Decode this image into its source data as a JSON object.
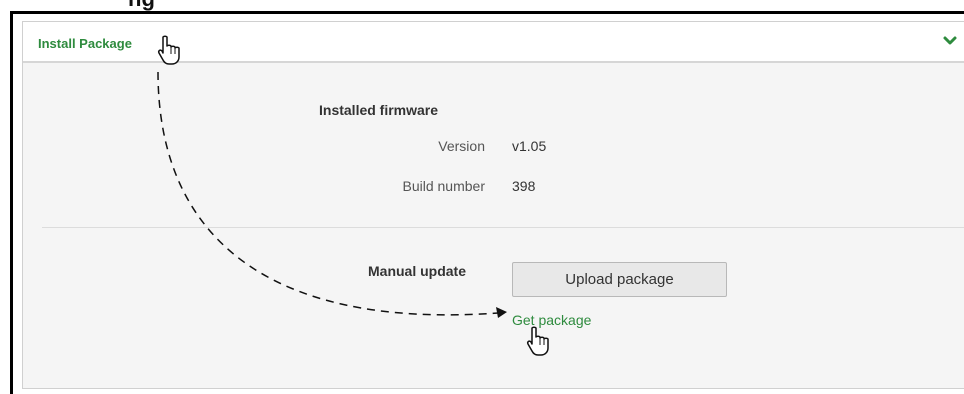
{
  "page_heading_fragment": "ng",
  "panel": {
    "title": "Install Package",
    "toggle_icon": "chevron-down-icon",
    "accent_color": "#2e8b3e"
  },
  "installed_firmware": {
    "heading": "Installed firmware",
    "version_label": "Version",
    "version_value": "v1.05",
    "build_label": "Build number",
    "build_value": "398"
  },
  "manual_update": {
    "heading": "Manual update",
    "upload_button_label": "Upload package",
    "get_package_link": "Get package"
  },
  "annotations": {
    "cursor_icons": [
      "hand-pointer-icon",
      "hand-pointer-icon"
    ],
    "arrow": "dashed-curved-arrow"
  }
}
